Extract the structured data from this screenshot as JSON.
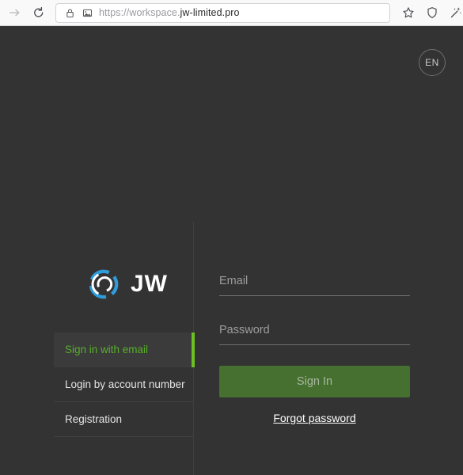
{
  "browser": {
    "forward_icon": "arrow-right-icon",
    "reload_icon": "reload-icon",
    "lock_icon": "padlock-icon",
    "page_icon": "image-placeholder-icon",
    "url_prefix": "https://workspace.",
    "url_domain": "jw-limited.pro",
    "star_icon": "star-icon",
    "shield_icon": "shield-icon",
    "extension_icon": "sparkle-wand-icon"
  },
  "page": {
    "language_selector": "EN",
    "background_color": "#333333"
  },
  "brand": {
    "logo_icon": "jw-circular-logo-icon",
    "name": "JW",
    "logo_ring_color": "#2f9bd8",
    "logo_mark_color": "#ffffff"
  },
  "tabs": [
    {
      "label": "Sign in with email",
      "active": true
    },
    {
      "label": "Login by account number",
      "active": false
    },
    {
      "label": "Registration",
      "active": false
    }
  ],
  "accent": {
    "active_tab_text": "#57b02a",
    "active_tab_indicator": "#6cc022",
    "button_green": "#467030"
  },
  "form": {
    "email": {
      "placeholder": "Email",
      "value": ""
    },
    "password": {
      "placeholder": "Password",
      "value": ""
    },
    "submit_label": "Sign In",
    "forgot_password_label": "Forgot password"
  }
}
